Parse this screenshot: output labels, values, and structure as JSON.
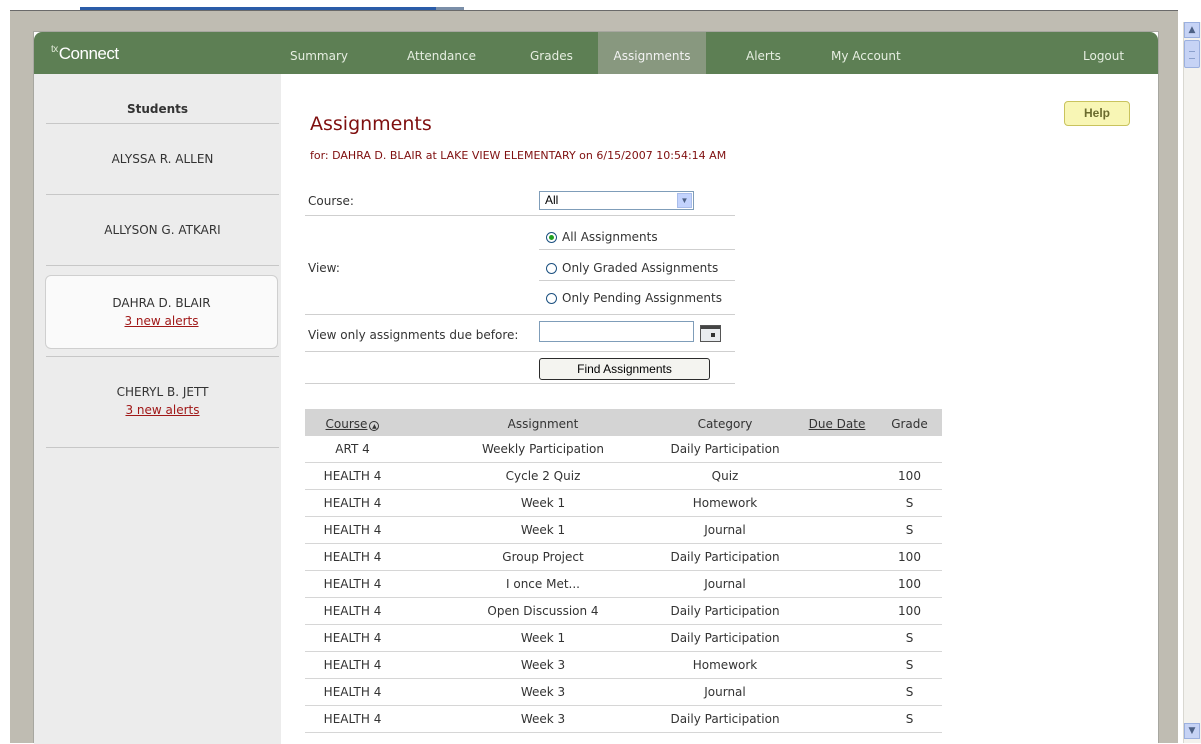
{
  "app": {
    "logo_prefix": "tx",
    "logo_text": "Connect"
  },
  "nav": {
    "items": [
      {
        "label": "Summary",
        "active": false
      },
      {
        "label": "Attendance",
        "active": false
      },
      {
        "label": "Grades",
        "active": false
      },
      {
        "label": "Assignments",
        "active": true
      },
      {
        "label": "Alerts",
        "active": false
      },
      {
        "label": "My Account",
        "active": false
      }
    ],
    "logout": "Logout"
  },
  "sidebar": {
    "title": "Students",
    "students": [
      {
        "name": "ALYSSA R. ALLEN",
        "alerts": ""
      },
      {
        "name": "ALLYSON G. ATKARI",
        "alerts": ""
      },
      {
        "name": "DAHRA D. BLAIR",
        "alerts": "3 new alerts"
      },
      {
        "name": "CHERYL B. JETT",
        "alerts": "3 new alerts"
      }
    ]
  },
  "main": {
    "title": "Assignments",
    "subtitle": "for: DAHRA D. BLAIR at LAKE VIEW ELEMENTARY on 6/15/2007 10:54:14 AM",
    "help": "Help"
  },
  "form": {
    "course_label": "Course:",
    "course_value": "All",
    "view_label": "View:",
    "view_options": [
      {
        "label": "All Assignments",
        "selected": true
      },
      {
        "label": "Only Graded Assignments",
        "selected": false
      },
      {
        "label": "Only Pending Assignments",
        "selected": false
      }
    ],
    "due_before_label": "View only assignments due before:",
    "due_before_value": "",
    "find_button": "Find Assignments"
  },
  "table": {
    "headers": {
      "course": "Course",
      "assignment": "Assignment",
      "category": "Category",
      "due_date": "Due Date",
      "grade": "Grade"
    },
    "rows": [
      {
        "course": "ART 4",
        "assignment": "Weekly Participation",
        "category": "Daily Participation",
        "due_date": "",
        "grade": ""
      },
      {
        "course": "HEALTH 4",
        "assignment": "Cycle 2 Quiz",
        "category": "Quiz",
        "due_date": "",
        "grade": "100"
      },
      {
        "course": "HEALTH 4",
        "assignment": "Week 1",
        "category": "Homework",
        "due_date": "",
        "grade": "S"
      },
      {
        "course": "HEALTH 4",
        "assignment": "Week 1",
        "category": "Journal",
        "due_date": "",
        "grade": "S"
      },
      {
        "course": "HEALTH 4",
        "assignment": "Group Project",
        "category": "Daily Participation",
        "due_date": "",
        "grade": "100"
      },
      {
        "course": "HEALTH 4",
        "assignment": "I once Met...",
        "category": "Journal",
        "due_date": "",
        "grade": "100"
      },
      {
        "course": "HEALTH 4",
        "assignment": "Open Discussion 4",
        "category": "Daily Participation",
        "due_date": "",
        "grade": "100"
      },
      {
        "course": "HEALTH 4",
        "assignment": "Week 1",
        "category": "Daily Participation",
        "due_date": "",
        "grade": "S"
      },
      {
        "course": "HEALTH 4",
        "assignment": "Week 3",
        "category": "Homework",
        "due_date": "",
        "grade": "S"
      },
      {
        "course": "HEALTH 4",
        "assignment": "Week 3",
        "category": "Journal",
        "due_date": "",
        "grade": "S"
      },
      {
        "course": "HEALTH 4",
        "assignment": "Week 3",
        "category": "Daily Participation",
        "due_date": "",
        "grade": "S"
      }
    ]
  }
}
